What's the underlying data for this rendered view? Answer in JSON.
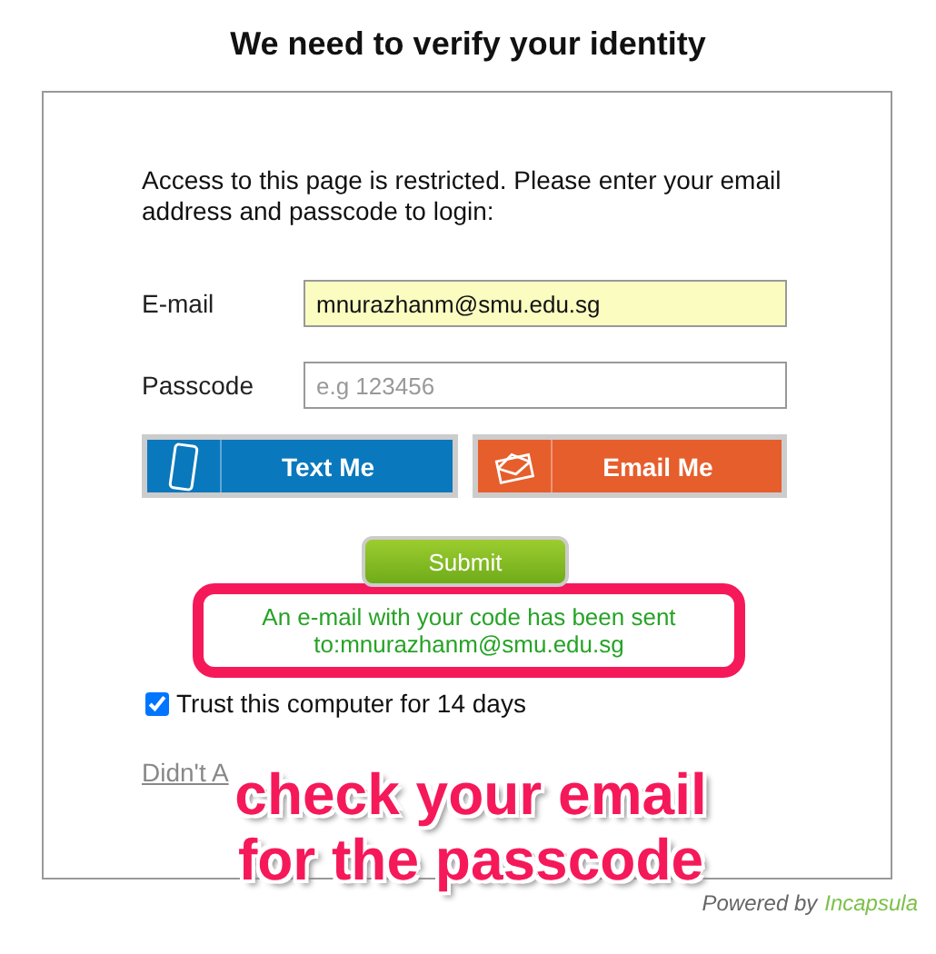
{
  "title": "We need to verify your identity",
  "intro": "Access to this page is restricted. Please enter your email address and passcode to login:",
  "fields": [
    {
      "label": "E-mail",
      "value": "mnurazhanm@smu.edu.sg",
      "autofilled": true
    },
    {
      "label": "Passcode",
      "placeholder": "e.g 123456",
      "autofilled": false
    }
  ],
  "methods": [
    {
      "kind": "phone",
      "label": "Text Me",
      "color": "#0a78bd"
    },
    {
      "kind": "mail",
      "label": "Email Me",
      "color": "#e65e2c"
    }
  ],
  "submit": "Submit",
  "message": "An e-mail with your code has been sent to:mnurazhanm@smu.edu.sg",
  "trust": {
    "label": "Trust this computer for 14 days",
    "checked": true
  },
  "link": "Didn't A",
  "annotation": [
    "check your email",
    "for the passcode"
  ],
  "footer": {
    "prefix": "Powered by",
    "brand": "Incapsula"
  }
}
